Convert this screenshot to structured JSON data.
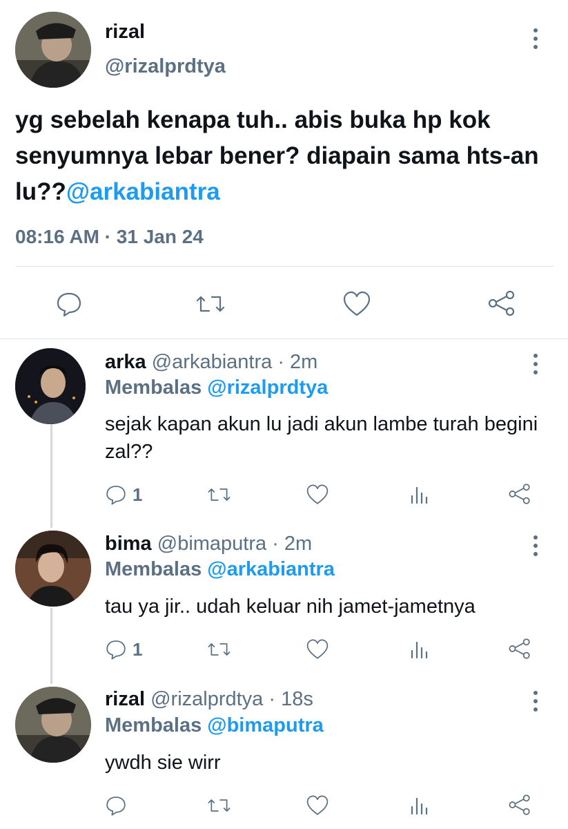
{
  "main_tweet": {
    "name": "rizal",
    "handle": "@rizalprdtya",
    "text": "yg sebelah kenapa tuh.. abis buka hp kok senyumnya lebar bener? diapain sama hts-an lu??",
    "mention": "@arkabiantra",
    "timestamp": "08:16 AM · 31 Jan 24"
  },
  "replies": [
    {
      "name": "arka",
      "handle": "@arkabiantra",
      "time": "· 2m",
      "reply_prefix": "Membalas",
      "reply_to": "@rizalprdtya",
      "text": "sejak kapan akun lu jadi akun lambe turah begini zal??",
      "reply_count": "1"
    },
    {
      "name": "bima",
      "handle": "@bimaputra",
      "time": "· 2m",
      "reply_prefix": "Membalas",
      "reply_to": "@arkabiantra",
      "text": "tau ya jir.. udah keluar nih jamet-jametnya",
      "reply_count": "1"
    },
    {
      "name": "rizal",
      "handle": "@rizalprdtya",
      "time": "· 18s",
      "reply_prefix": "Membalas",
      "reply_to": "@bimaputra",
      "text": "ywdh sie wirr",
      "reply_count": ""
    }
  ],
  "colors": {
    "accent": "#1d9bf0",
    "secondary_text": "#5b7083",
    "divider": "#dfe5ea"
  }
}
